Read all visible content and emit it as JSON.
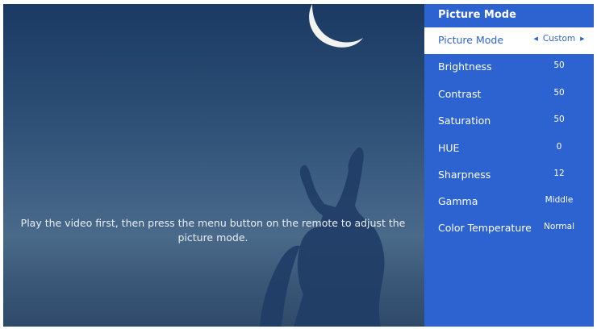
{
  "video": {
    "hint": "Play the video first, then press the menu button on the remote to adjust the picture mode."
  },
  "menu": {
    "title": "Picture Mode",
    "items": [
      {
        "label": "Picture Mode",
        "value": "Custom"
      },
      {
        "label": "Brightness",
        "value": "50"
      },
      {
        "label": "Contrast",
        "value": "50"
      },
      {
        "label": "Saturation",
        "value": "50"
      },
      {
        "label": "HUE",
        "value": "0"
      },
      {
        "label": "Sharpness",
        "value": "12"
      },
      {
        "label": "Gamma",
        "value": "Middle"
      },
      {
        "label": "Color Temperature",
        "value": "Normal"
      }
    ]
  }
}
